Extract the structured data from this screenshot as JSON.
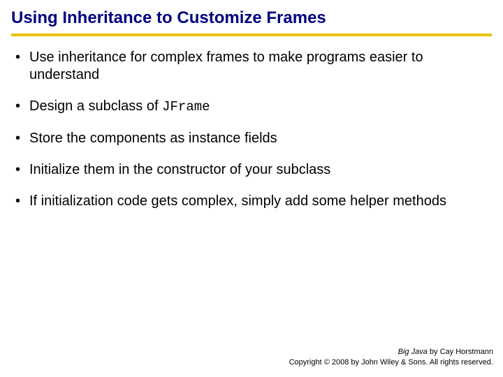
{
  "title": "Using Inheritance to Customize Frames",
  "bullets": [
    {
      "text": "Use inheritance for complex frames to make programs easier to understand"
    },
    {
      "prefix": "Design a subclass of ",
      "code": "JFrame"
    },
    {
      "text": "Store the components as instance fields"
    },
    {
      "text": "Initialize them in the constructor of your subclass"
    },
    {
      "text": "If initialization code gets complex, simply add some helper methods"
    }
  ],
  "footer": {
    "book_title": "Big Java",
    "byline": " by Cay Horstmann",
    "copyright": "Copyright © 2008 by John Wiley & Sons. All rights reserved."
  }
}
